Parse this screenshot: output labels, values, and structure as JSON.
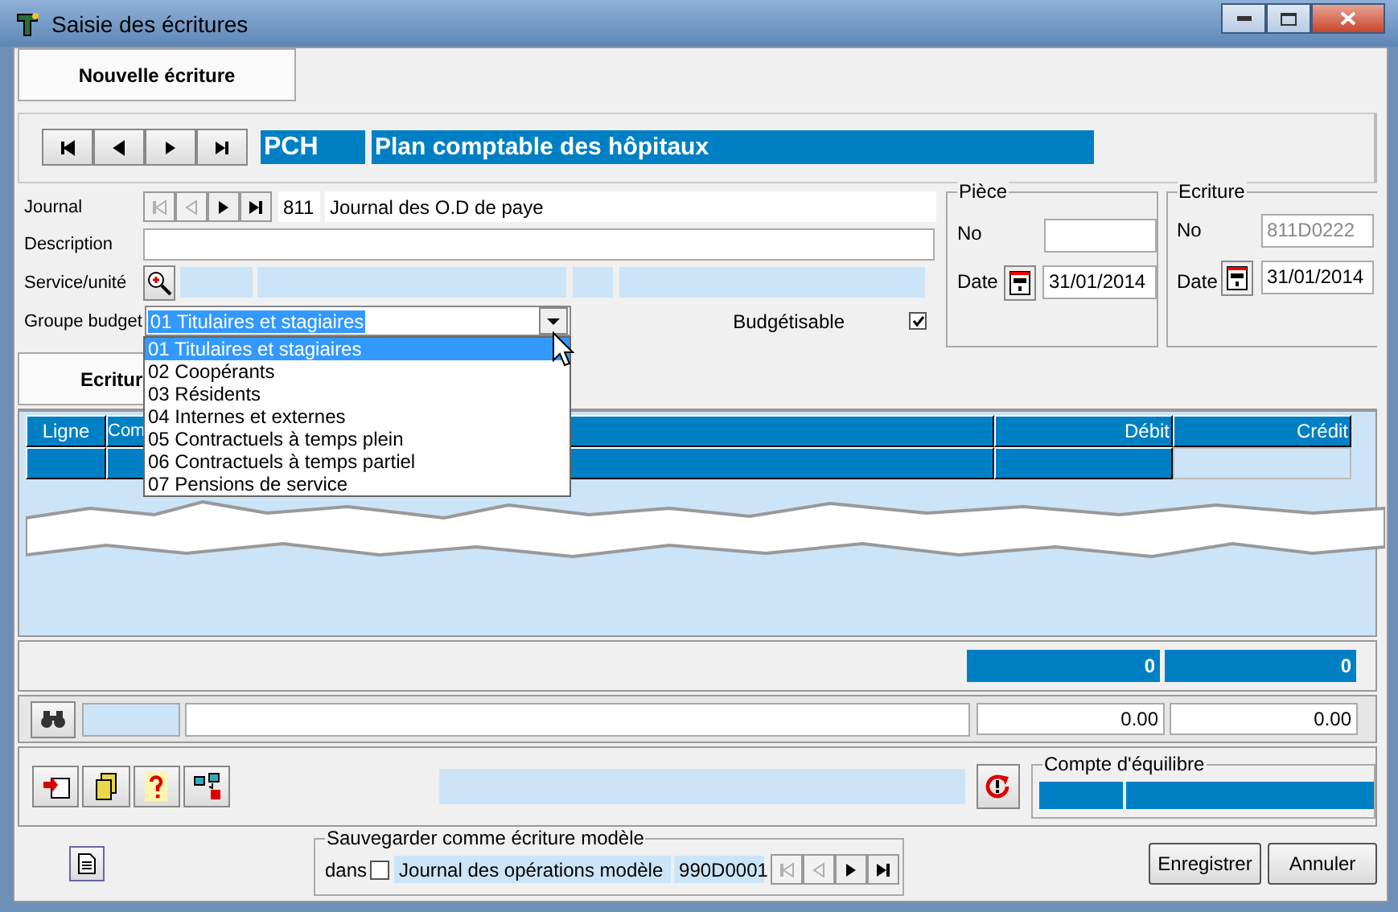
{
  "window": {
    "title": "Saisie des écritures"
  },
  "tabs": [
    {
      "label": "Nouvelle écriture",
      "selected": true
    }
  ],
  "plan": {
    "code": "PCH",
    "name": "Plan comptable des hôpitaux"
  },
  "journal": {
    "label": "Journal",
    "code": "811",
    "name": "Journal des O.D de paye",
    "nav": [
      {
        "kind": "first",
        "disabled": true
      },
      {
        "kind": "prev",
        "disabled": true
      },
      {
        "kind": "next",
        "disabled": false
      },
      {
        "kind": "last",
        "disabled": false
      }
    ]
  },
  "description": {
    "label": "Description"
  },
  "service": {
    "label": "Service/unité"
  },
  "groupe_budget": {
    "label": "Groupe budget",
    "value": "01 Titulaires et stagiaires",
    "options": [
      {
        "label": "01 Titulaires et stagiaires",
        "selected": true
      },
      {
        "label": "02 Coopérants",
        "selected": false
      },
      {
        "label": "03 Résidents",
        "selected": false
      },
      {
        "label": "04 Internes et externes",
        "selected": false
      },
      {
        "label": "05 Contractuels à temps plein",
        "selected": false
      },
      {
        "label": "06 Contractuels à temps partiel",
        "selected": false
      },
      {
        "label": "07 Pensions de service",
        "selected": false
      }
    ]
  },
  "budgetisable": {
    "label": "Budgétisable",
    "checked": true
  },
  "piece": {
    "title": "Pièce",
    "no_label": "No",
    "date_label": "Date",
    "date": "31/01/2014"
  },
  "ecriture": {
    "title": "Ecriture",
    "no_label": "No",
    "no": "811D0222",
    "date_label": "Date",
    "date": "31/01/2014"
  },
  "lines_tab": {
    "label": "Ecritur"
  },
  "table": {
    "columns": [
      "Ligne",
      "Com",
      "Débit",
      "Crédit"
    ]
  },
  "totals": {
    "debit": "0",
    "credit": "0"
  },
  "search_row": {
    "debit": "0.00",
    "credit": "0.00"
  },
  "balance": {
    "title": "Compte d'équilibre"
  },
  "model": {
    "title": "Sauvegarder comme écriture modèle",
    "in_label": "dans",
    "checked": false,
    "journal": "Journal des opérations modèle",
    "code": "990D0001",
    "nav": [
      {
        "kind": "first",
        "disabled": true
      },
      {
        "kind": "prev",
        "disabled": true
      },
      {
        "kind": "next",
        "disabled": false
      },
      {
        "kind": "last",
        "disabled": false
      }
    ]
  },
  "buttons": [
    {
      "label": "Enregistrer"
    },
    {
      "label": "Annuler"
    }
  ]
}
